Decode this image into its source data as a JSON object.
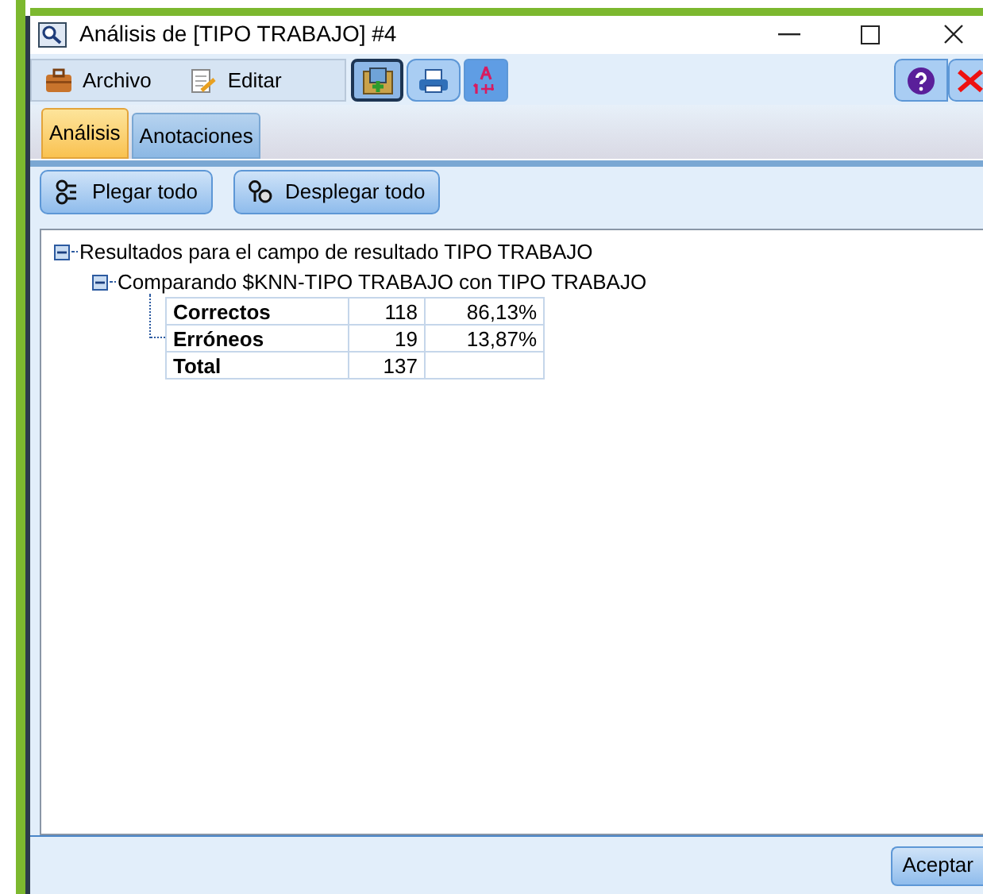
{
  "window": {
    "title": "Análisis de [TIPO TRABAJO] #4"
  },
  "menu": [
    {
      "label": "Archivo"
    },
    {
      "label": "Editar"
    }
  ],
  "tabs": [
    {
      "label": "Análisis",
      "selected": true
    },
    {
      "label": "Anotaciones",
      "selected": false
    }
  ],
  "actions": [
    {
      "label": "Plegar todo"
    },
    {
      "label": "Desplegar todo"
    }
  ],
  "tree": [
    {
      "label": "Resultados para el campo de resultado TIPO TRABAJO",
      "expanded": true,
      "children": [
        {
          "label": "Comparando $KNN-TIPO TRABAJO con TIPO TRABAJO",
          "expanded": true,
          "table": [
            [
              "Correctos",
              "118",
              "86,13%"
            ],
            [
              "Erróneos",
              "19",
              "13,87%"
            ],
            [
              "Total",
              "137"
            ]
          ]
        }
      ]
    }
  ],
  "ok_button": "Aceptar"
}
